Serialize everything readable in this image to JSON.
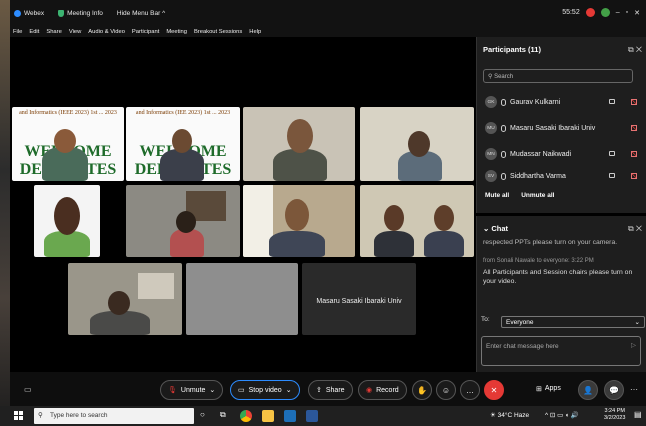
{
  "titlebar": {
    "app_name": "Webex",
    "meeting_info": "Meeting Info",
    "hide_menu": "Hide Menu Bar ^",
    "clock": "55:52"
  },
  "menubar": [
    "File",
    "Edit",
    "Share",
    "View",
    "Audio & Video",
    "Participant",
    "Meeting",
    "Breakout Sessions",
    "Help"
  ],
  "video_tiles": {
    "welcome_banner_1": "and Informatics (IEEE 2023) 1st ... 2023",
    "welcome_banner_2": "and Informatics (IEE 2023) 1st ... 2023",
    "welcome_big_1": "WELCOME DELEGATES",
    "welcome_big_2": "WELCOME DELEGATES",
    "name_tile": "Masaru Sasaki Ibaraki Univ"
  },
  "participants": {
    "title": "Participants (11)",
    "search_placeholder": "Search",
    "items": [
      {
        "initials": "GK",
        "name": "Gaurav Kulkarni"
      },
      {
        "initials": "MU",
        "name": "Masaru Sasaki Ibaraki Univ"
      },
      {
        "initials": "MN",
        "name": "Mudassar Naikwadi"
      },
      {
        "initials": "SV",
        "name": "Siddhartha Varma"
      }
    ],
    "mute_all": "Mute all",
    "unmute_all": "Unmute all"
  },
  "chat": {
    "title": "Chat",
    "prev_line": "respected PPTs please turn on your camera.",
    "from_line": "from Sonali Nawale to everyone:  3:22 PM",
    "message": "All Participants and Session chairs please turn on your video.",
    "to_label": "To:",
    "to_value": "Everyone",
    "input_placeholder": "Enter chat message here"
  },
  "controls": {
    "unmute": "Unmute",
    "stop_video": "Stop video",
    "share": "Share",
    "record": "Record",
    "apps": "Apps"
  },
  "taskbar": {
    "search_placeholder": "Type here to search",
    "weather": "34°C  Haze",
    "time": "3:24 PM",
    "date": "3/2/2023"
  },
  "colors": {
    "accent_blue": "#2d8cff",
    "end_red": "#e53935",
    "welcome_green": "#1e6b2a"
  }
}
